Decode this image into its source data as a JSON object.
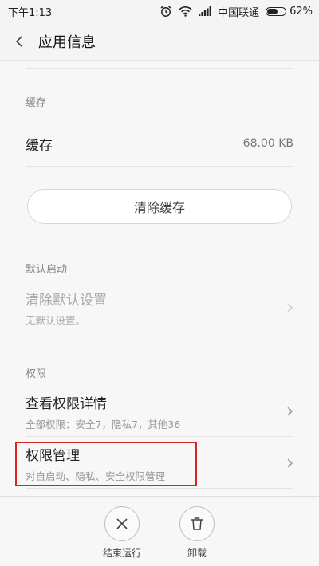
{
  "status_bar": {
    "time": "下午1:13",
    "carrier": "中国联通",
    "battery": "62%",
    "battery_level": 0.62
  },
  "header": {
    "title": "应用信息"
  },
  "cache_section": {
    "heading": "缓存",
    "row_label": "缓存",
    "row_value": "68.00 KB",
    "clear_button": "清除缓存"
  },
  "default_launch_section": {
    "heading": "默认启动",
    "row_title": "清除默认设置",
    "row_subtitle": "无默认设置。"
  },
  "permissions_section": {
    "heading": "权限",
    "items": [
      {
        "title": "查看权限详情",
        "subtitle": "全部权限：安全7，隐私7，其他36"
      },
      {
        "title": "权限管理",
        "subtitle": "对自启动、隐私、安全权限管理"
      }
    ]
  },
  "bottom_actions": [
    {
      "label": "结束运行",
      "icon": "close-icon"
    },
    {
      "label": "卸载",
      "icon": "trash-icon"
    }
  ],
  "colors": {
    "highlight_border": "#d8261d",
    "background": "#f7f7f7"
  }
}
